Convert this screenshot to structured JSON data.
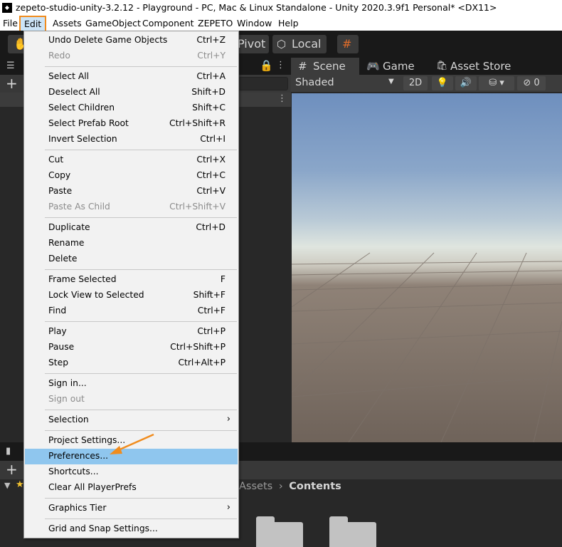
{
  "window": {
    "title": "zepeto-studio-unity-3.2.12 - Playground - PC, Mac & Linux Standalone - Unity 2020.3.9f1 Personal* <DX11>"
  },
  "menubar": {
    "items": [
      "File",
      "Edit",
      "Assets",
      "GameObject",
      "Component",
      "ZEPETO",
      "Window",
      "Help"
    ],
    "active": "Edit"
  },
  "toolbar": {
    "pivot_label": "Pivot",
    "local_label": "Local"
  },
  "scene_view": {
    "tabs": [
      "Scene",
      "Game",
      "Asset Store"
    ],
    "shading_mode": "Shaded",
    "mode_2d_label": "2D",
    "hidden_count": "0"
  },
  "project": {
    "breadcrumb": [
      "Assets",
      "Contents"
    ]
  },
  "edit_menu": {
    "items": [
      {
        "label": "Undo Delete Game Objects",
        "shortcut": "Ctrl+Z",
        "enabled": true
      },
      {
        "label": "Redo",
        "shortcut": "Ctrl+Y",
        "enabled": false
      },
      {
        "label": "Select All",
        "shortcut": "Ctrl+A",
        "enabled": true
      },
      {
        "label": "Deselect All",
        "shortcut": "Shift+D",
        "enabled": true
      },
      {
        "label": "Select Children",
        "shortcut": "Shift+C",
        "enabled": true
      },
      {
        "label": "Select Prefab Root",
        "shortcut": "Ctrl+Shift+R",
        "enabled": true
      },
      {
        "label": "Invert Selection",
        "shortcut": "Ctrl+I",
        "enabled": true
      },
      {
        "label": "Cut",
        "shortcut": "Ctrl+X",
        "enabled": true
      },
      {
        "label": "Copy",
        "shortcut": "Ctrl+C",
        "enabled": true
      },
      {
        "label": "Paste",
        "shortcut": "Ctrl+V",
        "enabled": true
      },
      {
        "label": "Paste As Child",
        "shortcut": "Ctrl+Shift+V",
        "enabled": false
      },
      {
        "label": "Duplicate",
        "shortcut": "Ctrl+D",
        "enabled": true
      },
      {
        "label": "Rename",
        "shortcut": "",
        "enabled": true
      },
      {
        "label": "Delete",
        "shortcut": "",
        "enabled": true
      },
      {
        "label": "Frame Selected",
        "shortcut": "F",
        "enabled": true
      },
      {
        "label": "Lock View to Selected",
        "shortcut": "Shift+F",
        "enabled": true
      },
      {
        "label": "Find",
        "shortcut": "Ctrl+F",
        "enabled": true
      },
      {
        "label": "Play",
        "shortcut": "Ctrl+P",
        "enabled": true
      },
      {
        "label": "Pause",
        "shortcut": "Ctrl+Shift+P",
        "enabled": true
      },
      {
        "label": "Step",
        "shortcut": "Ctrl+Alt+P",
        "enabled": true
      },
      {
        "label": "Sign in...",
        "shortcut": "",
        "enabled": true
      },
      {
        "label": "Sign out",
        "shortcut": "",
        "enabled": false
      },
      {
        "label": "Selection",
        "shortcut": "",
        "enabled": true,
        "submenu": true
      },
      {
        "label": "Project Settings...",
        "shortcut": "",
        "enabled": true
      },
      {
        "label": "Preferences...",
        "shortcut": "",
        "enabled": true,
        "highlighted": true
      },
      {
        "label": "Shortcuts...",
        "shortcut": "",
        "enabled": true
      },
      {
        "label": "Clear All PlayerPrefs",
        "shortcut": "",
        "enabled": true
      },
      {
        "label": "Graphics Tier",
        "shortcut": "",
        "enabled": true,
        "submenu": true
      },
      {
        "label": "Grid and Snap Settings...",
        "shortcut": "",
        "enabled": true
      }
    ]
  },
  "colors": {
    "menu_highlight": "#8fc6ee",
    "callout_orange": "#f08c1e"
  }
}
